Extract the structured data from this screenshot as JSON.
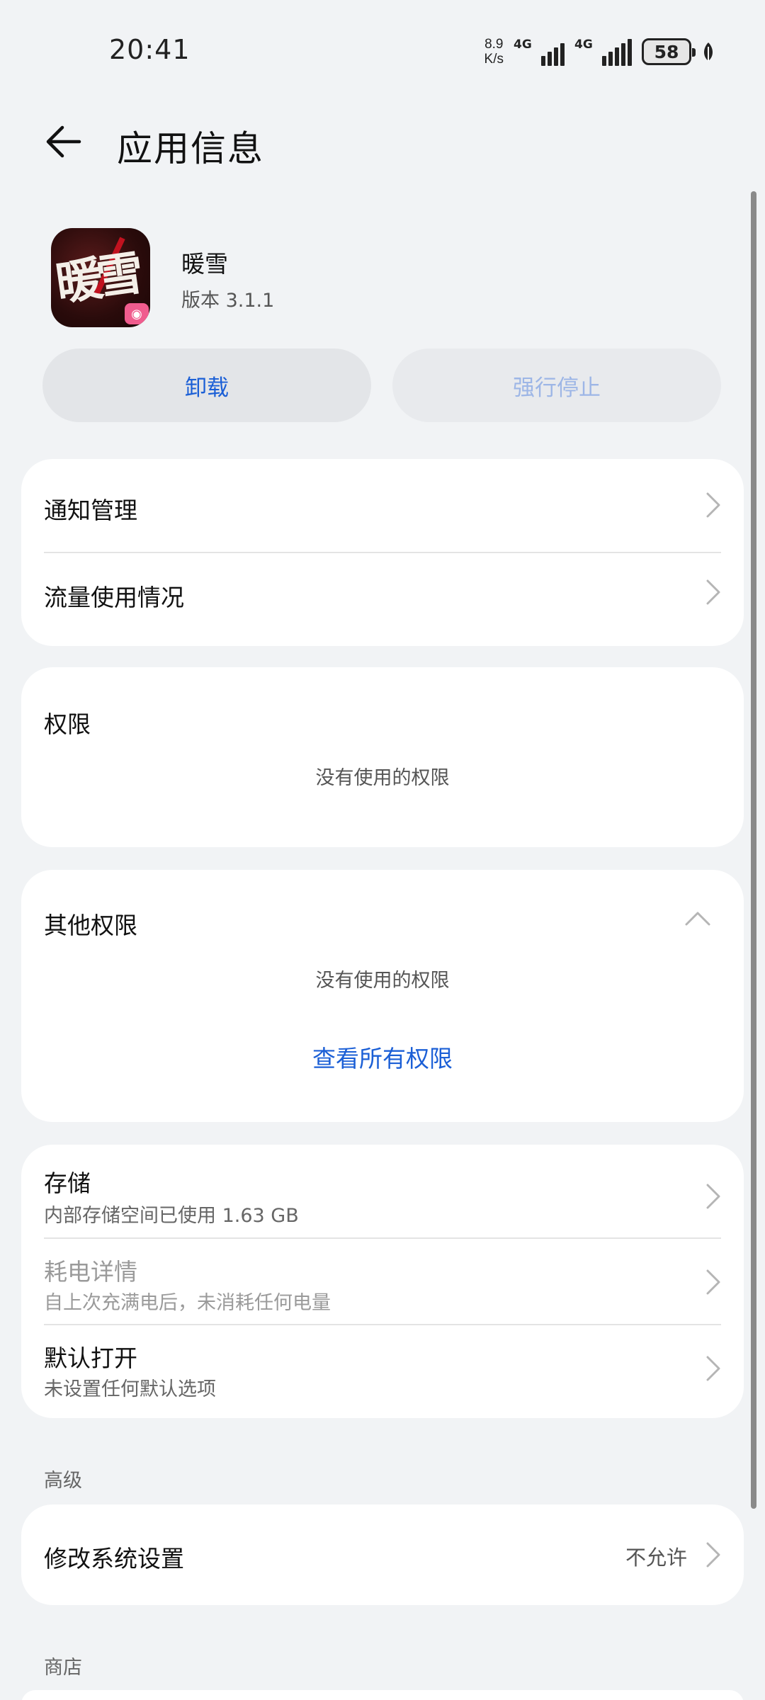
{
  "status_bar": {
    "time": "20:41",
    "net_speed_value": "8.9",
    "net_speed_unit": "K/s",
    "sim1": "4G",
    "sim2": "4G",
    "battery": "58"
  },
  "header": {
    "title": "应用信息"
  },
  "app": {
    "name": "暖雪",
    "version": "版本 3.1.1",
    "icon_text": "暖雪",
    "icon_badge": "◉"
  },
  "actions": {
    "uninstall_label": "卸载",
    "force_stop_label": "强行停止"
  },
  "group_general": {
    "notifications": "通知管理",
    "data_usage": "流量使用情况"
  },
  "permissions": {
    "title": "权限",
    "empty_text": "没有使用的权限"
  },
  "other_permissions": {
    "title": "其他权限",
    "empty_text": "没有使用的权限",
    "view_all_link": "查看所有权限"
  },
  "group_details": {
    "storage_title": "存储",
    "storage_sub": "内部存储空间已使用 1.63 GB",
    "power_title": "耗电详情",
    "power_sub": "自上次充满电后，未消耗任何电量",
    "default_open_title": "默认打开",
    "default_open_sub": "未设置任何默认选项"
  },
  "advanced": {
    "section_label": "高级",
    "modify_settings_title": "修改系统设置",
    "modify_settings_value": "不允许"
  },
  "store": {
    "section_label": "商店"
  },
  "colors": {
    "accent": "#1b5fd6",
    "background": "#f1f3f5",
    "card": "#ffffff"
  }
}
